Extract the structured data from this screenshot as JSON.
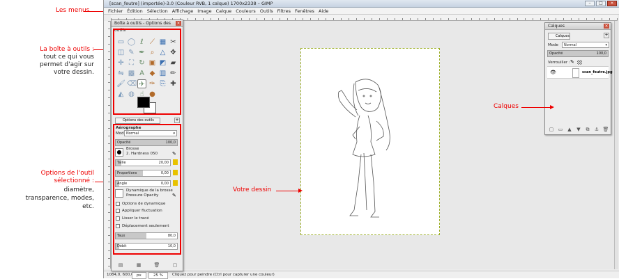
{
  "annotations": {
    "menus": "Les menus",
    "toolbox_title": "La boîte à outils :",
    "toolbox_desc": [
      "tout ce qui vous",
      "permet d'agir sur",
      "votre dessin."
    ],
    "options_title": [
      "Options de l'outil",
      "sélectionné :"
    ],
    "options_desc": [
      "diamètre,",
      "transparence, modes,",
      "etc."
    ],
    "drawing": "Votre dessin",
    "layers": "Calques"
  },
  "window": {
    "title": "[scan_feutre] (importée)-3.0 (Couleur RVB, 1 calque) 1700x2338 – GIMP",
    "controls": [
      "–",
      "□",
      "×"
    ]
  },
  "menubar": [
    "Fichier",
    "Édition",
    "Sélection",
    "Affichage",
    "Image",
    "Calque",
    "Couleurs",
    "Outils",
    "Filtres",
    "Fenêtres",
    "Aide"
  ],
  "toolbox": {
    "title": "Boîte à outils - Options des outils",
    "close": "×",
    "tools": [
      "rect-select",
      "ellipse-select",
      "free-select",
      "fuzzy-select",
      "color-select",
      "scissors-select",
      "foreground-select",
      "paths",
      "color-picker",
      "zoom",
      "measure",
      "move",
      "align",
      "crop",
      "rotate",
      "scale",
      "shear",
      "perspective",
      "flip",
      "cage",
      "text",
      "bucket-fill",
      "blend",
      "pencil",
      "paintbrush",
      "eraser",
      "airbrush",
      "ink",
      "clone",
      "heal",
      "perspective-clone",
      "blur",
      "smudge",
      "dodge-burn"
    ],
    "tool_glyphs": [
      "▭",
      "◯",
      "ℓ",
      "⟋",
      "▦",
      "✂",
      "◫",
      "✎",
      "✒",
      "⌕",
      "△",
      "✥",
      "✛",
      "⛶",
      "↻",
      "▣",
      "◩",
      "▰",
      "⇋",
      "▩",
      "A",
      "◆",
      "▥",
      "✏",
      "🖌",
      "⌫",
      "✈",
      "✑",
      "⎘",
      "✚",
      "◭",
      "◍",
      "☝",
      "●"
    ],
    "selected_tool": "airbrush",
    "fg_color": "#000000",
    "bg_color": "#ffffff"
  },
  "options": {
    "tab_label": "Options des outils",
    "tool_name": "Aérographe",
    "mode_label": "Mode",
    "mode_value": "Normal",
    "opacity_label": "Opacité",
    "opacity_value": "100,0",
    "brush_label": "Brosse",
    "brush_value": "2. Hardness 050",
    "size_label": "Taille",
    "size_value": "20,00",
    "aspect_label": "Proportions",
    "aspect_value": "0,00",
    "angle_label": "Angle",
    "angle_value": "0,00",
    "dynamics_label": "Dynamique de la brosse",
    "dynamics_value": "Pressure Opacity",
    "checks": [
      "Options de dynamique",
      "Appliquer fluctuation",
      "Lisser le tracé",
      "Déplacement seulement"
    ],
    "rate_label": "Taux",
    "rate_value": "80,0",
    "flow_label": "Débit",
    "flow_value": "10,0"
  },
  "layers": {
    "title": "Calques",
    "tab_label": "Calques",
    "mode_label": "Mode",
    "mode_value": "Normal",
    "opacity_label": "Opacité",
    "opacity_value": "100,0",
    "lock_label": "Verrouiller :",
    "layer_name": "scan_feutre.jpg"
  },
  "statusbar": {
    "coords": "1084,0, 600,0",
    "unit": "px",
    "zoom": "25 %",
    "message": "Cliquez pour peindre (Ctrl pour capturer une couleur)"
  }
}
